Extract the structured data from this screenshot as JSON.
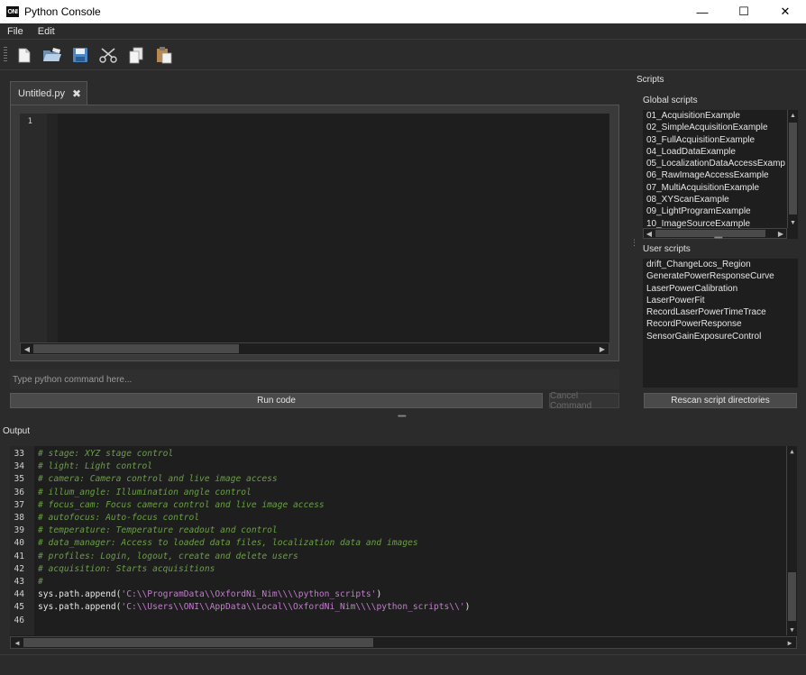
{
  "window": {
    "logo_text": "ONI",
    "title": "Python Console",
    "minimize": "—",
    "maximize": "☐",
    "close": "✕"
  },
  "menu": [
    {
      "label": "File"
    },
    {
      "label": "Edit"
    }
  ],
  "toolbar": {
    "icons": [
      "new-file-icon",
      "open-folder-icon",
      "save-icon",
      "cut-icon",
      "copy-icon",
      "paste-icon"
    ]
  },
  "editor": {
    "tab_label": "Untitled.py",
    "tab_close": "✖",
    "line_number": "1"
  },
  "command": {
    "placeholder": "Type python command here...",
    "run_label": "Run code",
    "cancel_label": "Cancel Command"
  },
  "scripts": {
    "header": "Scripts",
    "global_label": "Global scripts",
    "global_items": [
      "01_AcquisitionExample",
      "02_SimpleAcquisitionExample",
      "03_FullAcquisitionExample",
      "04_LoadDataExample",
      "05_LocalizationDataAccessExamp",
      "06_RawImageAccessExample",
      "07_MultiAcquisitionExample",
      "08_XYScanExample",
      "09_LightProgramExample",
      "10_ImageSourceExample"
    ],
    "user_label": "User scripts",
    "user_items": [
      "drift_ChangeLocs_Region",
      "GeneratePowerResponseCurve",
      "LaserPowerCalibration",
      "LaserPowerFit",
      "RecordLaserPowerTimeTrace",
      "RecordPowerResponse",
      "SensorGainExposureControl"
    ],
    "rescan_label": "Rescan script directories"
  },
  "output": {
    "label": "Output",
    "lines": [
      {
        "n": "33",
        "segments": [
          {
            "t": "# stage: XYZ stage control",
            "c": "comment"
          }
        ]
      },
      {
        "n": "34",
        "segments": [
          {
            "t": "# light: Light control",
            "c": "comment"
          }
        ]
      },
      {
        "n": "35",
        "segments": [
          {
            "t": "# camera: Camera control and live image access",
            "c": "comment"
          }
        ]
      },
      {
        "n": "36",
        "segments": [
          {
            "t": "# illum_angle: Illumination angle control",
            "c": "comment"
          }
        ]
      },
      {
        "n": "37",
        "segments": [
          {
            "t": "# focus_cam: Focus camera control and live image access",
            "c": "comment"
          }
        ]
      },
      {
        "n": "38",
        "segments": [
          {
            "t": "# autofocus: Auto-focus control",
            "c": "comment"
          }
        ]
      },
      {
        "n": "39",
        "segments": [
          {
            "t": "# temperature: Temperature readout and control",
            "c": "comment"
          }
        ]
      },
      {
        "n": "40",
        "segments": [
          {
            "t": "# data_manager: Access to loaded data files, localization data and images",
            "c": "comment"
          }
        ]
      },
      {
        "n": "41",
        "segments": [
          {
            "t": "# profiles: Login, logout, create and delete users",
            "c": "comment"
          }
        ]
      },
      {
        "n": "42",
        "segments": [
          {
            "t": "# acquisition: Starts acquisitions",
            "c": "comment"
          }
        ]
      },
      {
        "n": "43",
        "segments": [
          {
            "t": "#",
            "c": "comment"
          }
        ]
      },
      {
        "n": "44",
        "segments": [
          {
            "t": "sys.path.append(",
            "c": "plain"
          },
          {
            "t": "'C:\\\\ProgramData\\\\OxfordNi_Nim\\\\\\\\python_scripts'",
            "c": "str"
          },
          {
            "t": ")",
            "c": "plain"
          }
        ]
      },
      {
        "n": "45",
        "segments": [
          {
            "t": "sys.path.append(",
            "c": "plain"
          },
          {
            "t": "'C:\\\\Users\\\\ONI\\\\AppData\\\\Local\\\\OxfordNi_Nim\\\\\\\\python_scripts\\\\'",
            "c": "str"
          },
          {
            "t": ")",
            "c": "plain"
          }
        ]
      },
      {
        "n": "46",
        "segments": []
      }
    ]
  },
  "colors": {
    "background": "#2b2b2b",
    "editor": "#1e1e1e",
    "comment": "#6a9f45",
    "string": "#c67ad1"
  }
}
